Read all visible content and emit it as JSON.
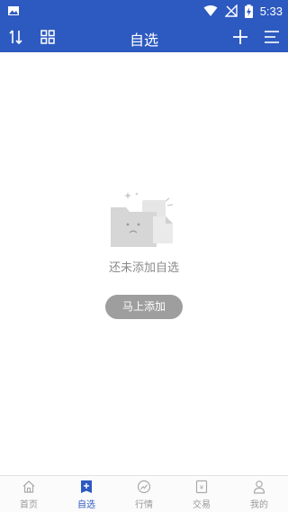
{
  "status_bar": {
    "time": "5:33",
    "icons": [
      "image-icon",
      "wifi-icon",
      "no-signal-icon",
      "battery-charging-icon"
    ]
  },
  "nav": {
    "title": "自选",
    "left_icons": [
      "sort-icon",
      "grid-icon"
    ],
    "right_icons": [
      "add-icon",
      "menu-icon"
    ]
  },
  "empty_state": {
    "message": "还未添加自选",
    "button_label": "马上添加",
    "illustration": "empty-folder-icon"
  },
  "tabs": [
    {
      "label": "首页",
      "icon": "home-icon",
      "active": false
    },
    {
      "label": "自选",
      "icon": "add-square-icon",
      "active": true
    },
    {
      "label": "行情",
      "icon": "trend-circle-icon",
      "active": false
    },
    {
      "label": "交易",
      "icon": "yen-card-icon",
      "active": false
    },
    {
      "label": "我的",
      "icon": "user-icon",
      "active": false
    }
  ],
  "colors": {
    "brand": "#2d5ac0",
    "tab_inactive": "#9a9a9a",
    "button_bg": "#9e9e9e",
    "empty_text": "#8a8a8a"
  }
}
